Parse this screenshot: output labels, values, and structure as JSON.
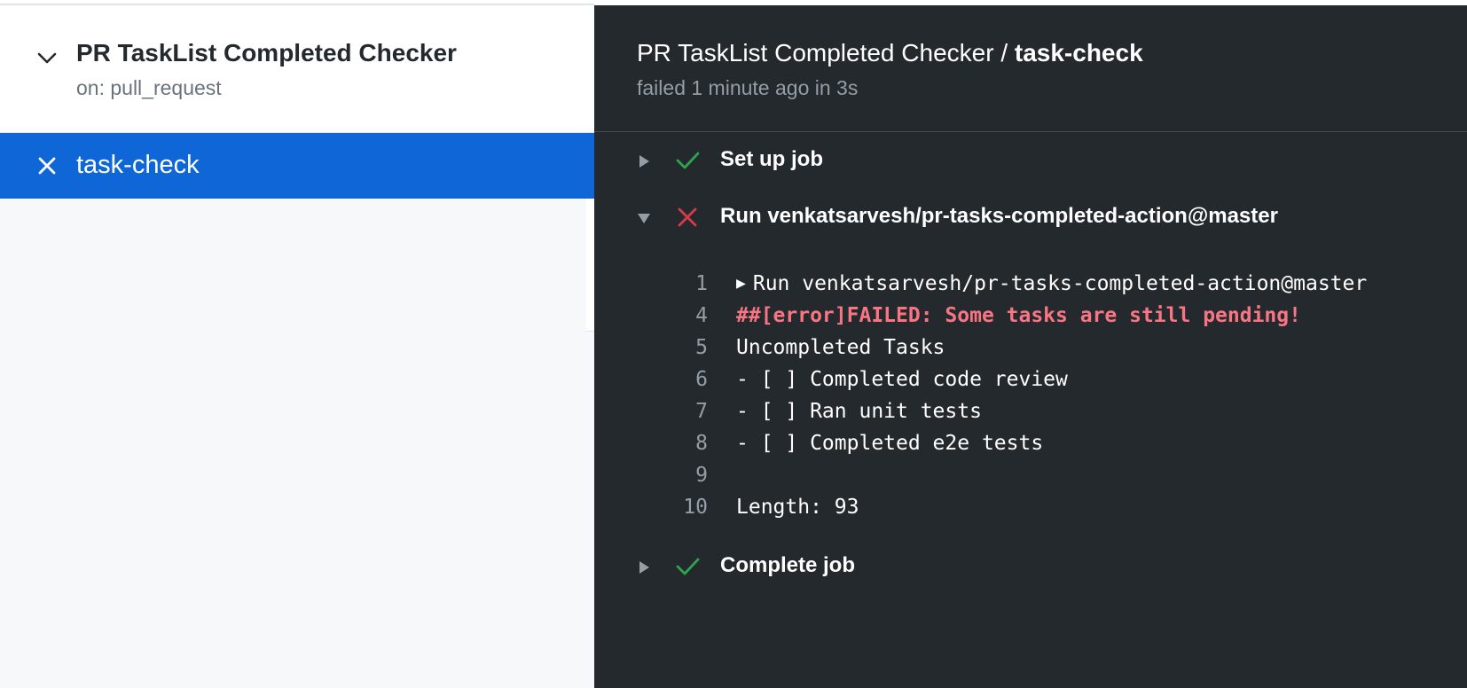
{
  "sidebar": {
    "workflow": {
      "title": "PR TaskList Completed Checker",
      "trigger": "on: pull_request"
    },
    "jobs": [
      {
        "label": "task-check",
        "status": "failed",
        "selected": true
      }
    ]
  },
  "run": {
    "workflow_name": "PR TaskList Completed Checker",
    "separator": "/",
    "job_name": "task-check",
    "status": "failed 1 minute ago in 3s"
  },
  "steps": [
    {
      "name": "Set up job",
      "status": "success",
      "expanded": false
    },
    {
      "name": "Run venkatsarvesh/pr-tasks-completed-action@master",
      "status": "failure",
      "expanded": true
    },
    {
      "name": "Complete job",
      "status": "success",
      "expanded": false
    }
  ],
  "log": [
    {
      "num": "1",
      "text": "Run venkatsarvesh/pr-tasks-completed-action@master",
      "collapsible": true
    },
    {
      "num": "4",
      "text": "##[error]FAILED: Some tasks are still pending!",
      "error": true
    },
    {
      "num": "5",
      "text": "Uncompleted Tasks"
    },
    {
      "num": "6",
      "text": "- [ ] Completed code review"
    },
    {
      "num": "7",
      "text": "- [ ] Ran unit tests"
    },
    {
      "num": "8",
      "text": "- [ ] Completed e2e tests"
    },
    {
      "num": "9",
      "text": ""
    },
    {
      "num": "10",
      "text": "Length: 93"
    }
  ],
  "colors": {
    "success": "#2ea44f",
    "failure": "#d73a49",
    "selected_bg": "#0f66d6",
    "dark_bg": "#24292e",
    "error_text": "#f97583"
  },
  "icons": {
    "workflow_toggle": "chevron-down-icon",
    "job_status": "x-icon",
    "step_success": "check-icon",
    "step_failure": "x-icon",
    "collapsed": "triangle-right-icon",
    "expanded": "triangle-down-icon"
  }
}
